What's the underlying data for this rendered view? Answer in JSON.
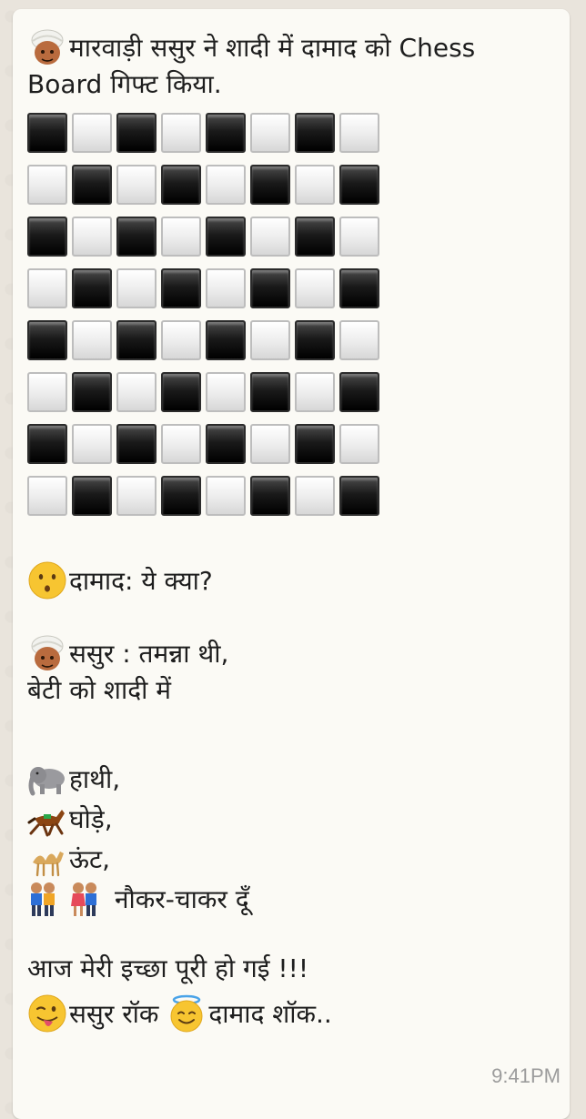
{
  "message": {
    "line1": "मारवाड़ी ससुर ने शादी में दामाद को Chess Board गिफ्ट किया.",
    "q_line": "दामाद: ये क्या?",
    "sasur_line": "ससुर : तमन्ना थी,",
    "beti_line": "बेटी को शादी में",
    "items": [
      {
        "icon": "elephant-icon",
        "text": "हाथी,"
      },
      {
        "icon": "horse-icon",
        "text": "घोड़े,"
      },
      {
        "icon": "camel-icon",
        "text": "ऊंट,"
      },
      {
        "icon": "people-icon",
        "text": "नौकर-चाकर दूँ"
      }
    ],
    "final_line": "आज मेरी इच्छा पूरी हो गई !!!",
    "rock_part1": "ससुर रॉक",
    "rock_part2": "दामाद शॉक.."
  },
  "timestamp": "9:41PM",
  "board": {
    "rows": 8,
    "cols": 8,
    "first_square": "black"
  },
  "colors": {
    "bubble": "#fbfaf5",
    "background": "#e9e4dc",
    "text": "#1e1e1e",
    "timestamp": "#9c9c9c"
  }
}
